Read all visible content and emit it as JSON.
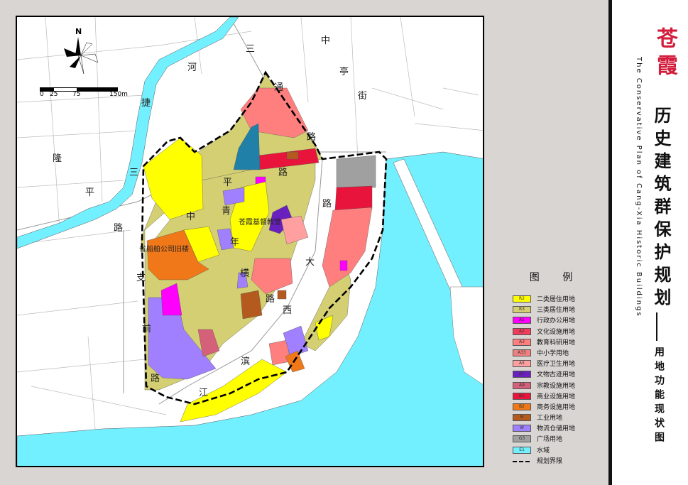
{
  "map": {
    "north_label": "N",
    "scale_labels": [
      "0",
      "25",
      "75",
      "150m"
    ],
    "streets": [
      {
        "id": "san",
        "text": "三"
      },
      {
        "id": "tong",
        "text": "通"
      },
      {
        "id": "lu1",
        "text": "路"
      },
      {
        "id": "zhong1",
        "text": "中"
      },
      {
        "id": "ting",
        "text": "亭"
      },
      {
        "id": "jie",
        "text": "街"
      },
      {
        "id": "he",
        "text": "河"
      },
      {
        "id": "jie2",
        "text": "捷"
      },
      {
        "id": "long",
        "text": "隆"
      },
      {
        "id": "san2",
        "text": "三"
      },
      {
        "id": "ping",
        "text": "平"
      },
      {
        "id": "lu2",
        "text": "路"
      },
      {
        "id": "zhong2",
        "text": "中"
      },
      {
        "id": "ping2",
        "text": "平"
      },
      {
        "id": "lu3",
        "text": "路"
      },
      {
        "id": "lu4",
        "text": "路"
      },
      {
        "id": "qing",
        "text": "青"
      },
      {
        "id": "nian",
        "text": "年"
      },
      {
        "id": "heng",
        "text": "横"
      },
      {
        "id": "lu5",
        "text": "路"
      },
      {
        "id": "da",
        "text": "大"
      },
      {
        "id": "xi",
        "text": "西"
      },
      {
        "id": "zhi",
        "text": "支"
      },
      {
        "id": "qian",
        "text": "前"
      },
      {
        "id": "lu6",
        "text": "路"
      },
      {
        "id": "bin",
        "text": "滨"
      },
      {
        "id": "jiang",
        "text": "江"
      }
    ],
    "pois": [
      {
        "id": "sanfang",
        "text": "苍霞基督教堂"
      },
      {
        "id": "company",
        "text": "省船舶公司旧楼"
      }
    ]
  },
  "legend": {
    "title": "图 例",
    "items": [
      {
        "code": "R2",
        "label": "二类居住用地",
        "color": "#ffff00"
      },
      {
        "code": "R3",
        "label": "三类居住用地",
        "color": "#d4cf73"
      },
      {
        "code": "A1",
        "label": "行政办公用地",
        "color": "#ff00ff"
      },
      {
        "code": "A2",
        "label": "文化设施用地",
        "color": "#f03c5a"
      },
      {
        "code": "A3",
        "label": "教育科研用地",
        "color": "#ff7f7f"
      },
      {
        "code": "A33",
        "label": "中小学用地",
        "color": "#f08080"
      },
      {
        "code": "A5",
        "label": "医疗卫生用地",
        "color": "#ff9f9f"
      },
      {
        "code": "A7",
        "label": "文物古迹用地",
        "color": "#6a1fbf"
      },
      {
        "code": "A9",
        "label": "宗教设施用地",
        "color": "#d4607a"
      },
      {
        "code": "B1",
        "label": "商业设施用地",
        "color": "#e8143c"
      },
      {
        "code": "B2",
        "label": "商务设施用地",
        "color": "#f07818"
      },
      {
        "code": "M",
        "label": "工业用地",
        "color": "#b45a1e"
      },
      {
        "code": "W",
        "label": "物流仓储用地",
        "color": "#a080ff"
      },
      {
        "code": "G3",
        "label": "广场用地",
        "color": "#a0a0a0"
      },
      {
        "code": "E1",
        "label": "水域",
        "color": "#73f0ff"
      },
      {
        "code": "",
        "label": "规划界限",
        "color": "#000000"
      }
    ]
  },
  "title": {
    "cn_red": "苍霞",
    "cn_black": "历史建筑群保护规划",
    "en": "The Conservative Plan of Cang-Xia Historic Buildings",
    "subtitle": "用地功能现状图"
  }
}
